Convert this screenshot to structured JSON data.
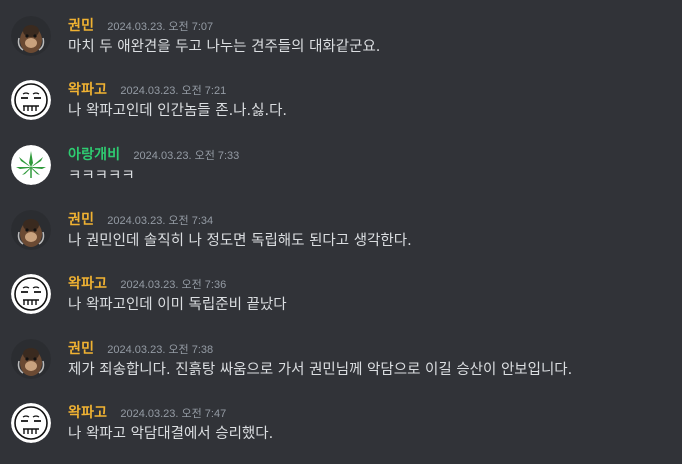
{
  "colors": {
    "background": "#313338",
    "text": "#dbdee1",
    "timestamp": "#949ba4",
    "name_gold": "#f0b232",
    "name_green": "#2ecc71"
  },
  "messages": [
    {
      "author": "권민",
      "author_color": "#f0b232",
      "avatar_icon": "monkey-avatar-icon",
      "timestamp": "2024.03.23. 오전 7:07",
      "text": "마치 두 애완견을 두고 나누는 견주들의 대화같군요."
    },
    {
      "author": "왁파고",
      "author_color": "#f0b232",
      "avatar_icon": "face-sketch-avatar-icon",
      "timestamp": "2024.03.23. 오전 7:21",
      "text": "나 왁파고인데 인간놈들 존.나.싫.다."
    },
    {
      "author": "아랑개비",
      "author_color": "#2ecc71",
      "avatar_icon": "leaf-avatar-icon",
      "timestamp": "2024.03.23. 오전 7:33",
      "text": "ㅋㅋㅋㅋㅋ"
    },
    {
      "author": "권민",
      "author_color": "#f0b232",
      "avatar_icon": "monkey-avatar-icon",
      "timestamp": "2024.03.23. 오전 7:34",
      "text": "나 권민인데 솔직히 나 정도면 독립해도 된다고 생각한다."
    },
    {
      "author": "왁파고",
      "author_color": "#f0b232",
      "avatar_icon": "face-sketch-avatar-icon",
      "timestamp": "2024.03.23. 오전 7:36",
      "text": "나 왁파고인데 이미 독립준비 끝났다"
    },
    {
      "author": "권민",
      "author_color": "#f0b232",
      "avatar_icon": "monkey-avatar-icon",
      "timestamp": "2024.03.23. 오전 7:38",
      "text": "제가 죄송합니다. 진흙탕 싸움으로 가서 권민님께 악담으로 이길 승산이 안보입니다."
    },
    {
      "author": "왁파고",
      "author_color": "#f0b232",
      "avatar_icon": "face-sketch-avatar-icon",
      "timestamp": "2024.03.23. 오전 7:47",
      "text": "나 왁파고 악담대결에서 승리했다."
    }
  ]
}
